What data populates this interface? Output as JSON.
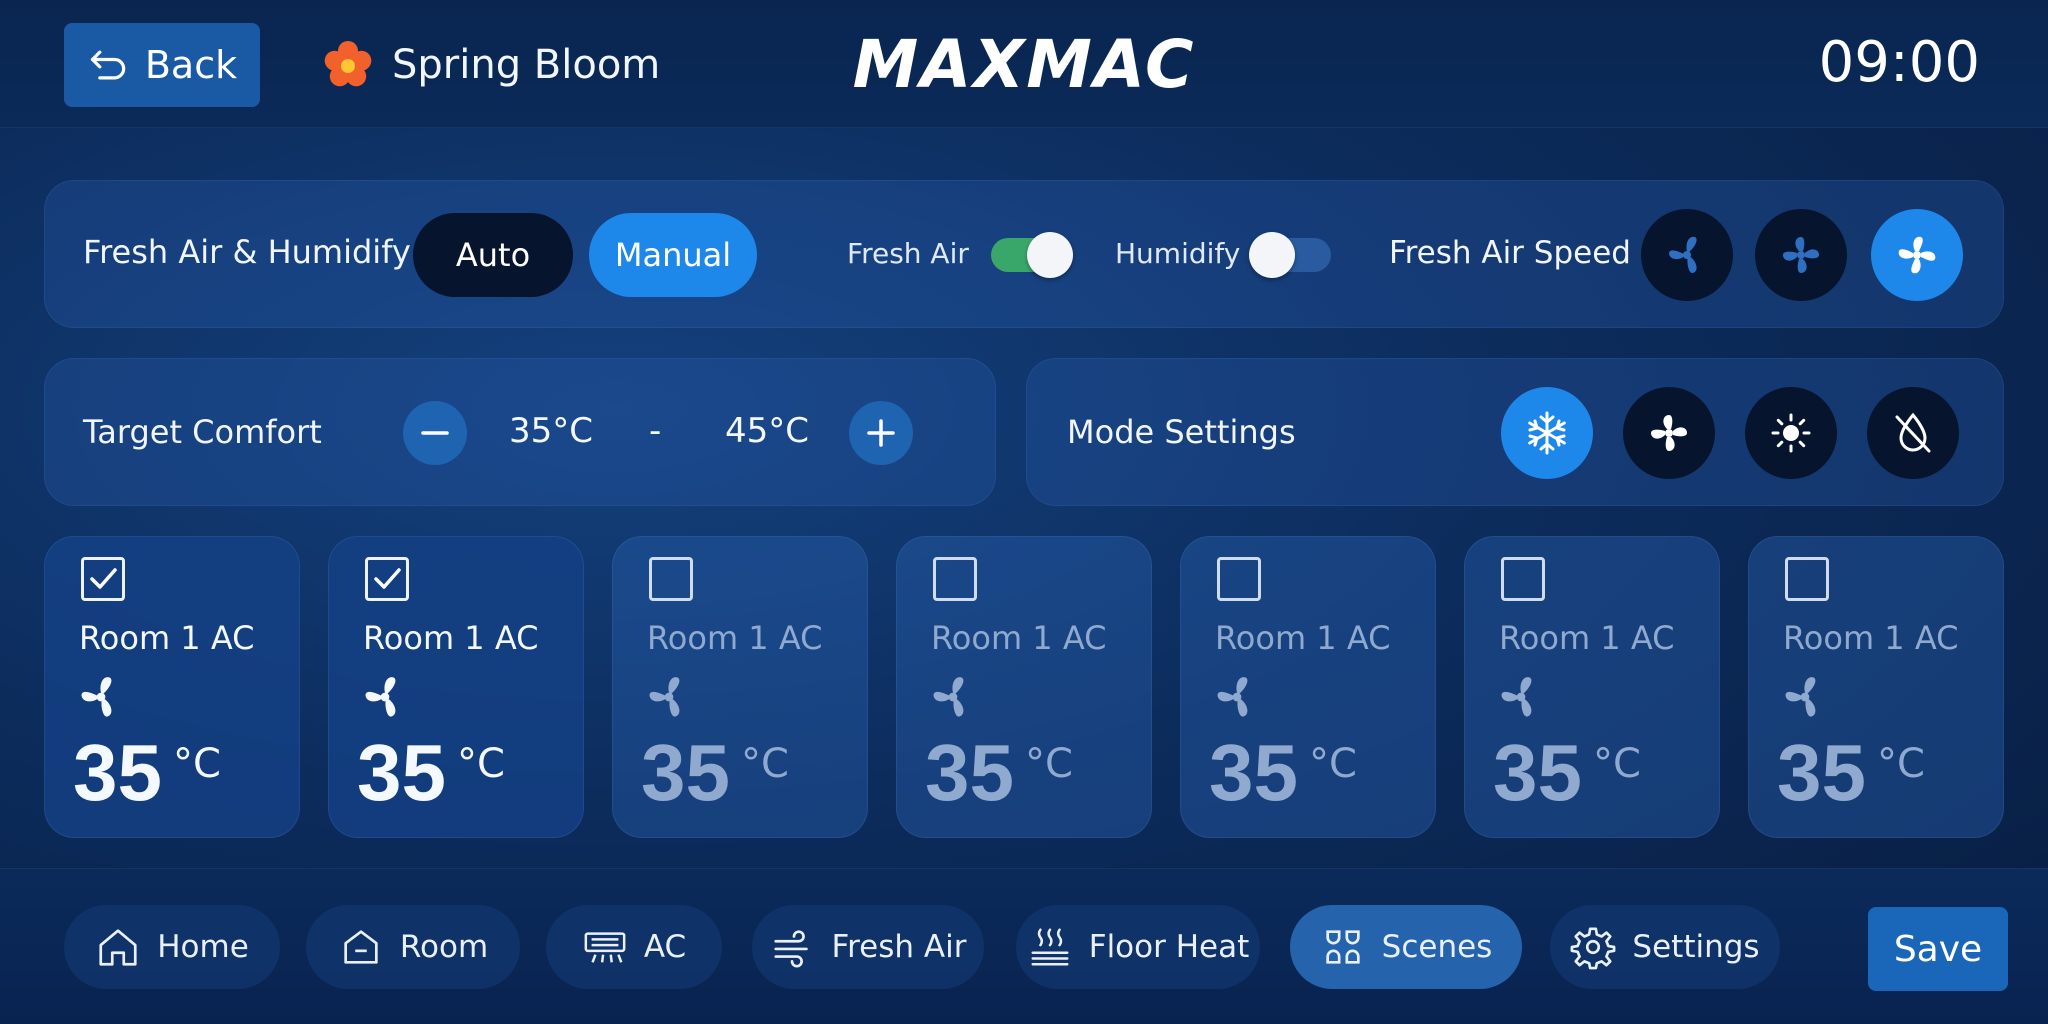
{
  "header": {
    "back_label": "Back",
    "scene_name": "Spring Bloom",
    "brand": "MAXMAC",
    "time": "09:00"
  },
  "fresh_air": {
    "title": "Fresh Air & Humidify",
    "mode_options": [
      "Auto",
      "Manual"
    ],
    "selected_mode": "Manual",
    "fresh_air_label": "Fresh Air",
    "fresh_air_on": true,
    "humidify_label": "Humidify",
    "humidify_on": false,
    "speed_label": "Fresh Air Speed",
    "speed_selected": 3,
    "speed_levels": 3
  },
  "target": {
    "title": "Target Comfort",
    "low": "35°C",
    "separator": "-",
    "high": "45°C"
  },
  "mode": {
    "title": "Mode Settings",
    "options": [
      "cool-snowflake-icon",
      "fan-icon",
      "heat-sun-icon",
      "dry-off-icon"
    ],
    "selected": "cool-snowflake-icon"
  },
  "rooms": [
    {
      "name": "Room 1 AC",
      "temp": "35",
      "unit": "°C",
      "checked": true
    },
    {
      "name": "Room 1 AC",
      "temp": "35",
      "unit": "°C",
      "checked": true
    },
    {
      "name": "Room 1 AC",
      "temp": "35",
      "unit": "°C",
      "checked": false
    },
    {
      "name": "Room 1 AC",
      "temp": "35",
      "unit": "°C",
      "checked": false
    },
    {
      "name": "Room 1 AC",
      "temp": "35",
      "unit": "°C",
      "checked": false
    },
    {
      "name": "Room 1 AC",
      "temp": "35",
      "unit": "°C",
      "checked": false
    },
    {
      "name": "Room 1 AC",
      "temp": "35",
      "unit": "°C",
      "checked": false
    }
  ],
  "nav": {
    "items": [
      {
        "label": "Home",
        "icon": "home-icon"
      },
      {
        "label": "Room",
        "icon": "room-icon"
      },
      {
        "label": "AC",
        "icon": "ac-unit-icon"
      },
      {
        "label": "Fresh Air",
        "icon": "wind-icon"
      },
      {
        "label": "Floor Heat",
        "icon": "floor-heat-icon"
      },
      {
        "label": "Scenes",
        "icon": "scenes-icon"
      },
      {
        "label": "Settings",
        "icon": "gear-icon"
      }
    ],
    "active": "Scenes",
    "save_label": "Save"
  },
  "colors": {
    "accent": "#1e88ea",
    "dark_button": "#06142e",
    "switch_on": "#3aa76a"
  }
}
